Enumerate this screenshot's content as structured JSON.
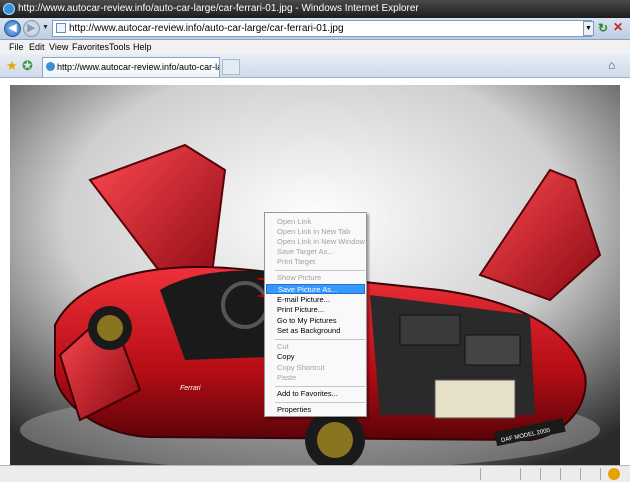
{
  "window": {
    "title": "http://www.autocar-review.info/auto-car-large/car-ferrari-01.jpg - Windows Internet Explorer"
  },
  "address_bar": {
    "url": "http://www.autocar-review.info/auto-car-large/car-ferrari-01.jpg"
  },
  "menu_bar": {
    "items": [
      "File",
      "Edit",
      "View",
      "Favorites",
      "Tools",
      "Help"
    ]
  },
  "tabs": {
    "active_tab_label": "http://www.autocar-review.info/auto-car-large/car-f..."
  },
  "image": {
    "badge_text": "Ferrari",
    "plate_text": "DAF MODEL 2000"
  },
  "context_menu": {
    "items": [
      {
        "label": "Open Link",
        "enabled": false
      },
      {
        "label": "Open Link in New Tab",
        "enabled": false
      },
      {
        "label": "Open Link in New Window",
        "enabled": false
      },
      {
        "label": "Save Target As...",
        "enabled": false
      },
      {
        "label": "Print Target",
        "enabled": false
      },
      {
        "label": "Show Picture",
        "enabled": false
      },
      {
        "label": "Save Picture As...",
        "enabled": true,
        "selected": true
      },
      {
        "label": "E-mail Picture...",
        "enabled": true
      },
      {
        "label": "Print Picture...",
        "enabled": true
      },
      {
        "label": "Go to My Pictures",
        "enabled": true
      },
      {
        "label": "Set as Background",
        "enabled": true
      },
      {
        "label": "Cut",
        "enabled": false
      },
      {
        "label": "Copy",
        "enabled": true
      },
      {
        "label": "Copy Shortcut",
        "enabled": false
      },
      {
        "label": "Paste",
        "enabled": false
      },
      {
        "label": "Add to Favorites...",
        "enabled": true
      },
      {
        "label": "Properties",
        "enabled": true
      }
    ]
  },
  "colors": {
    "selection": "#3399ff",
    "car_red": "#c4121a",
    "highlight_dash": "#c00000"
  }
}
